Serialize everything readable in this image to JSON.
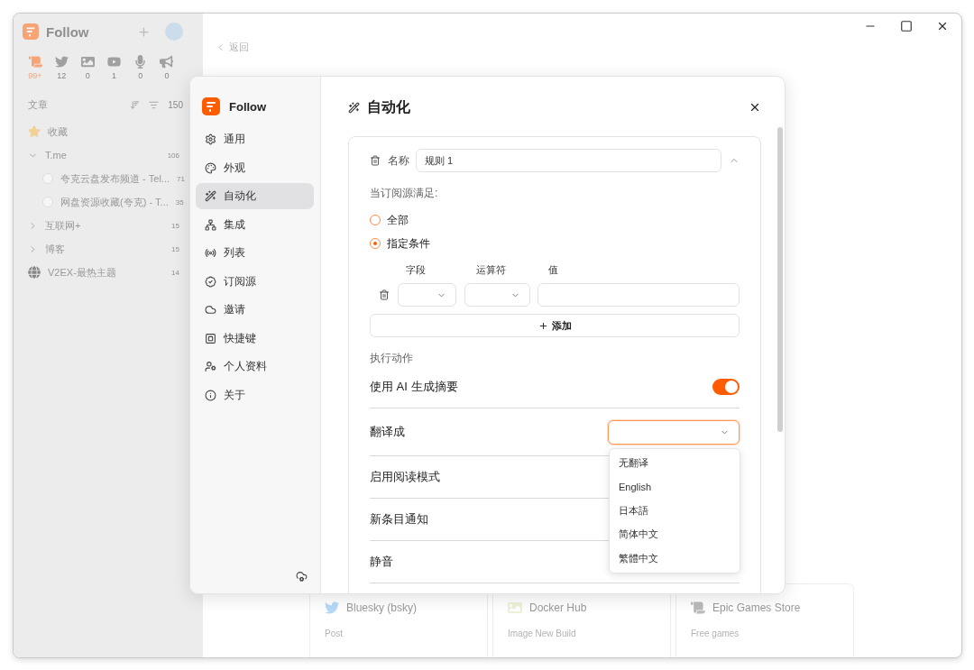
{
  "background": {
    "sidebar": {
      "app_name": "Follow",
      "categories": [
        {
          "count": "99+",
          "selected": true
        },
        {
          "count": "12",
          "selected": false
        },
        {
          "count": "0",
          "selected": false
        },
        {
          "count": "1",
          "selected": false
        },
        {
          "count": "0",
          "selected": false
        },
        {
          "count": "0",
          "selected": false
        }
      ],
      "section": {
        "title": "文章",
        "count": "150"
      },
      "feeds": [
        {
          "kind": "starred",
          "label": "收藏"
        },
        {
          "kind": "folder",
          "label": "T.me",
          "count": "106",
          "expanded": true,
          "children": [
            {
              "kind": "feed",
              "label": "夸克云盘发布频道 - Tel...",
              "count": "71"
            },
            {
              "kind": "feed",
              "label": "网盘资源收藏(夸克) - T...",
              "count": "35"
            }
          ]
        },
        {
          "kind": "folder",
          "label": "互联网+",
          "count": "15",
          "expanded": false
        },
        {
          "kind": "folder",
          "label": "博客",
          "count": "15",
          "expanded": false
        },
        {
          "kind": "feed",
          "label": "V2EX-最热主题",
          "count": "14"
        }
      ]
    },
    "back_link": "返回",
    "cards": [
      {
        "title": "Bluesky (bsky)",
        "subtitle": "Post"
      },
      {
        "title": "Docker Hub",
        "subtitle": "Image New Build"
      },
      {
        "title": "Epic Games Store",
        "subtitle": "Free games"
      }
    ]
  },
  "settings": {
    "app_name": "Follow",
    "nav": [
      {
        "label": "通用",
        "selected": false
      },
      {
        "label": "外观",
        "selected": false
      },
      {
        "label": "自动化",
        "selected": true
      },
      {
        "label": "集成",
        "selected": false
      },
      {
        "label": "列表",
        "selected": false
      },
      {
        "label": "订阅源",
        "selected": false
      },
      {
        "label": "邀请",
        "selected": false
      },
      {
        "label": "快捷键",
        "selected": false
      },
      {
        "label": "个人资料",
        "selected": false
      },
      {
        "label": "关于",
        "selected": false
      }
    ],
    "title": "自动化",
    "rule": {
      "name_label": "名称",
      "name_value": "规则 1",
      "expanded": true,
      "condition_label": "当订阅源满足:",
      "match_options": [
        {
          "label": "全部",
          "selected": false
        },
        {
          "label": "指定条件",
          "selected": true
        }
      ],
      "columns": [
        "字段",
        "运算符",
        "值"
      ],
      "add_button": "添加",
      "actions_label": "执行动作",
      "actions": [
        {
          "kind": "switch",
          "label": "使用 AI 生成摘要",
          "on": true
        },
        {
          "kind": "select",
          "label": "翻译成",
          "open": true,
          "options": [
            "无翻译",
            "English",
            "日本語",
            "简体中文",
            "繁體中文"
          ]
        },
        {
          "kind": "plain",
          "label": "启用阅读模式"
        },
        {
          "kind": "plain",
          "label": "新条目通知"
        },
        {
          "kind": "plain",
          "label": "静音"
        }
      ]
    }
  }
}
